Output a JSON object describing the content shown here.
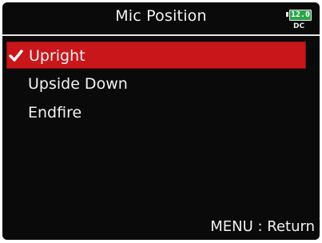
{
  "header": {
    "title": "Mic Position",
    "battery": {
      "value": "12.0",
      "source": "DC",
      "color": "#2aa44a"
    }
  },
  "menu": {
    "items": [
      {
        "label": "Upright",
        "selected": true,
        "icon": "check-icon"
      },
      {
        "label": "Upside Down",
        "selected": false
      },
      {
        "label": "Endfire",
        "selected": false
      }
    ]
  },
  "footer": {
    "hint": "MENU : Return"
  },
  "colors": {
    "selection": "#c9161b",
    "background": "#0a0a0a",
    "text": "#f2f2f2"
  }
}
